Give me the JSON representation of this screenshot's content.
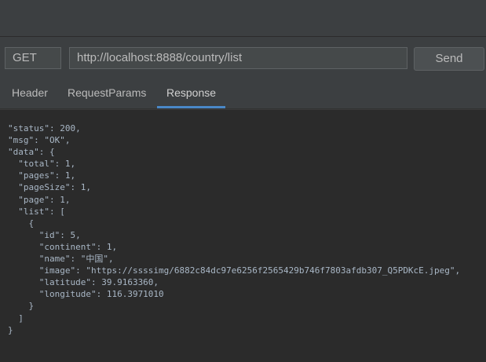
{
  "request": {
    "method": "GET",
    "url": "http://localhost:8888/country/list",
    "send_label": "Send"
  },
  "tabs": [
    {
      "label": "Header",
      "active": false
    },
    {
      "label": "RequestParams",
      "active": false
    },
    {
      "label": "Response",
      "active": true
    }
  ],
  "response": {
    "lines": [
      "\"status\": 200,",
      "\"msg\": \"OK\",",
      "\"data\": {",
      "  \"total\": 1,",
      "  \"pages\": 1,",
      "  \"pageSize\": 1,",
      "  \"page\": 1,",
      "  \"list\": [",
      "    {",
      "      \"id\": 5,",
      "      \"continent\": 1,",
      "      \"name\": \"中国\",",
      "      \"image\": \"https://ssssimg/6882c84dc97e6256f2565429b746f7803afdb307_Q5PDKcE.jpeg\",",
      "      \"latitude\": 39.9163360,",
      "      \"longitude\": 116.3971010",
      "    }",
      "  ]",
      "}"
    ]
  },
  "colors": {
    "background": "#3c3f41",
    "editor_background": "#2b2b2b",
    "text": "#bbbbbb",
    "accent": "#4a88c7"
  }
}
